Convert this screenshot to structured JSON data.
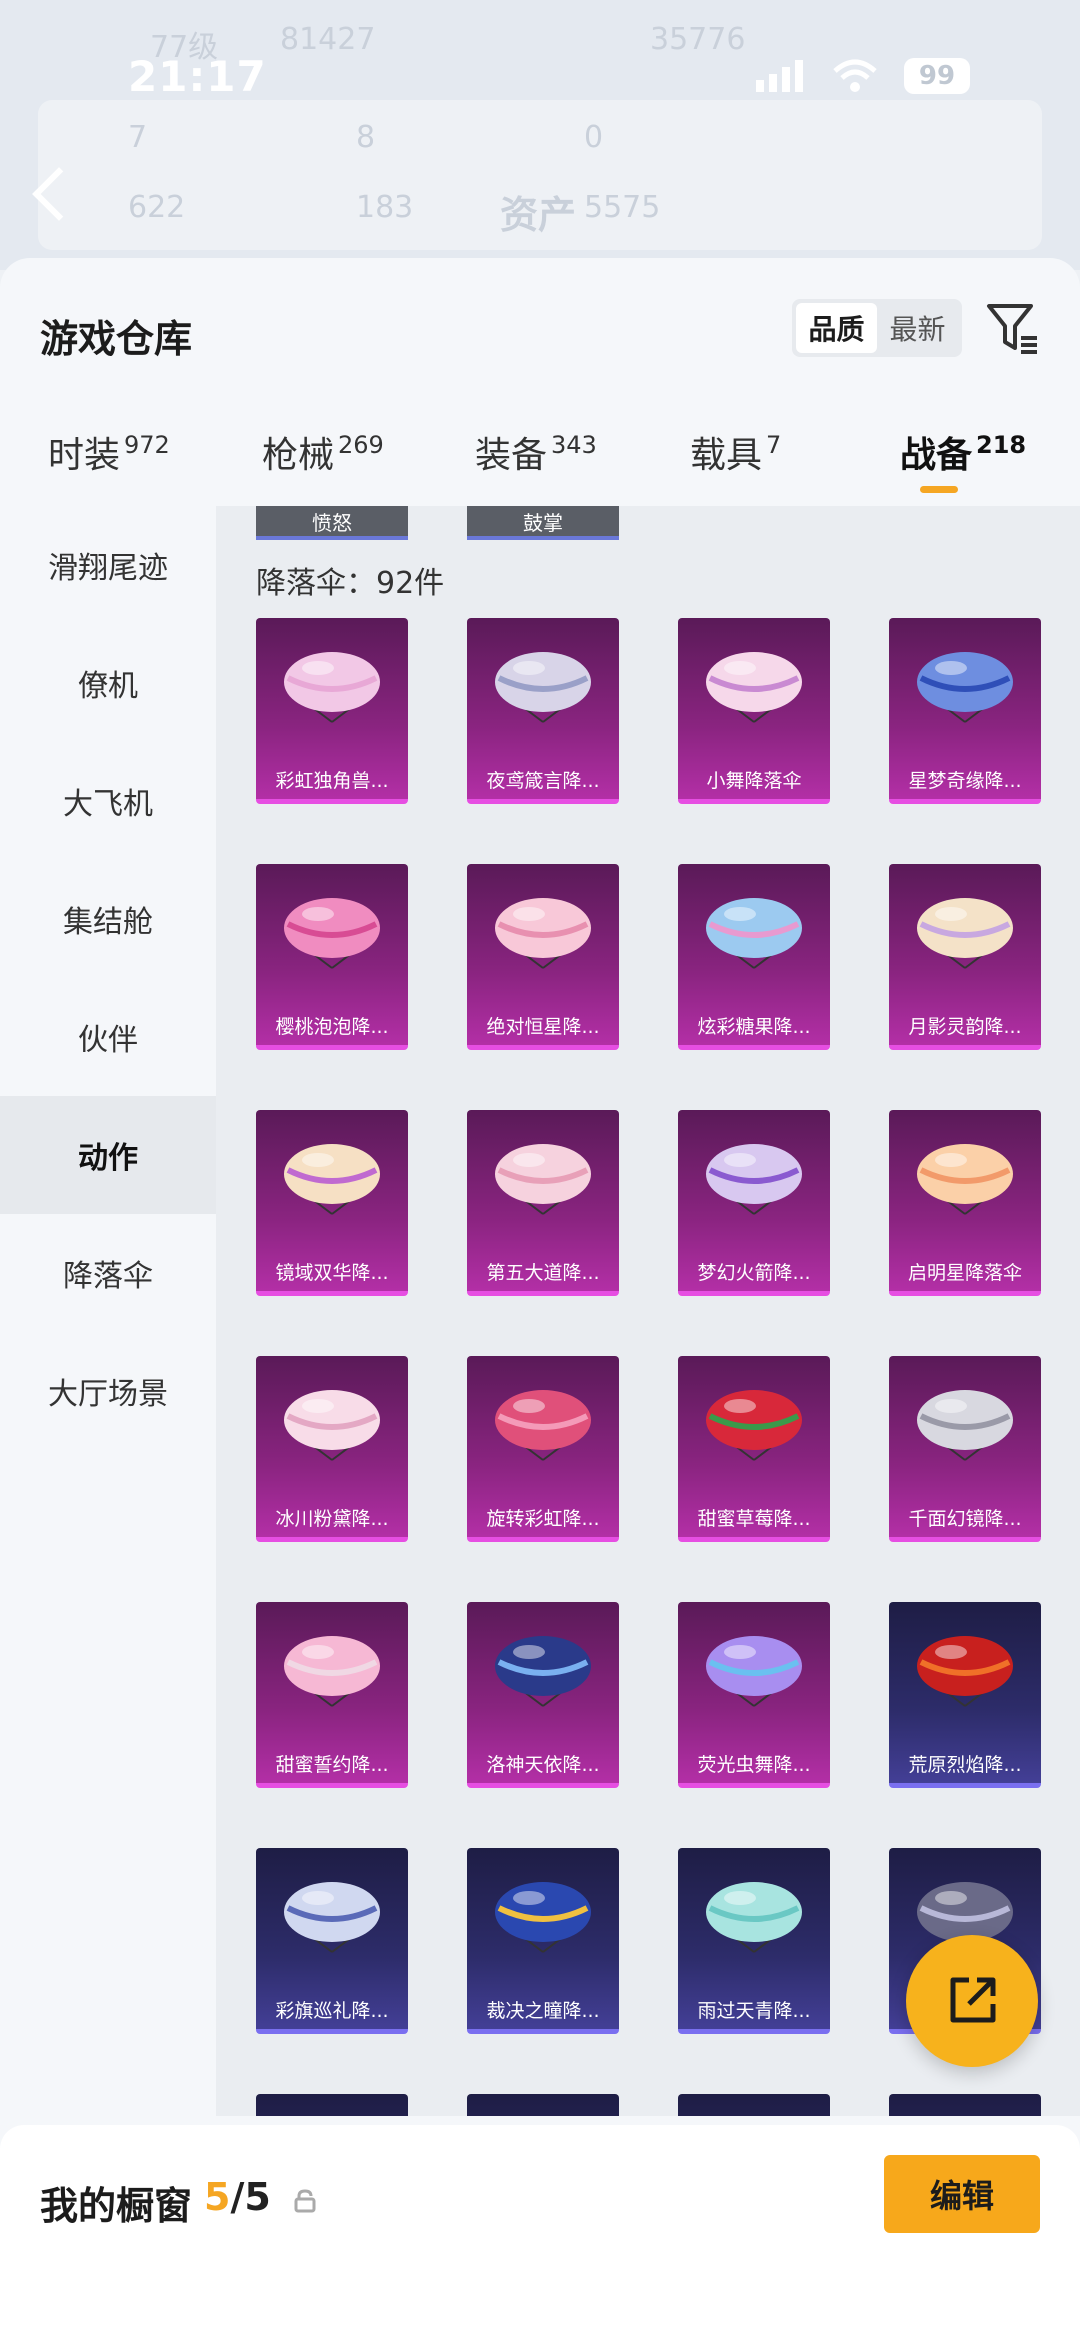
{
  "status_bar": {
    "time": "21:17",
    "battery": "99"
  },
  "bg_header": {
    "level": "77级",
    "score1": "81427",
    "score2": "35776",
    "stat_a": "7",
    "stat_b": "8",
    "stat_c": "0",
    "stat_d": "622",
    "stat_e": "183",
    "assets_label": "资产",
    "assets_value": "5575"
  },
  "sheet": {
    "title": "游戏仓库"
  },
  "sort": {
    "quality": "品质",
    "latest": "最新"
  },
  "tabs": [
    {
      "label": "时装",
      "count": "972"
    },
    {
      "label": "枪械",
      "count": "269"
    },
    {
      "label": "装备",
      "count": "343"
    },
    {
      "label": "载具",
      "count": "7"
    },
    {
      "label": "战备",
      "count": "218"
    }
  ],
  "sidebar": {
    "items": [
      "滑翔尾迹",
      "僚机",
      "大飞机",
      "集结舱",
      "伙伴",
      "动作",
      "降落伞",
      "大厅场景"
    ]
  },
  "chips": [
    "愤怒",
    "鼓掌"
  ],
  "section": {
    "count_label": "降落伞：92件"
  },
  "items": [
    {
      "name": "彩虹独角兽...",
      "color": "#f2c8e6",
      "accent": "#e8a8d6",
      "rarity": "purple"
    },
    {
      "name": "夜鸢箴言降...",
      "color": "#d8d4e8",
      "accent": "#9aa0c8",
      "rarity": "purple"
    },
    {
      "name": "小舞降落伞",
      "color": "#f6d8ea",
      "accent": "#c98ad2",
      "rarity": "purple"
    },
    {
      "name": "星梦奇缘降...",
      "color": "#6e8ee0",
      "accent": "#2f4fb8",
      "rarity": "purple"
    },
    {
      "name": "樱桃泡泡降...",
      "color": "#f08cc0",
      "accent": "#d84c94",
      "rarity": "purple"
    },
    {
      "name": "绝对恒星降...",
      "color": "#f8c8d8",
      "accent": "#e890b0",
      "rarity": "purple"
    },
    {
      "name": "炫彩糖果降...",
      "color": "#9ccaf0",
      "accent": "#e89ad0",
      "rarity": "purple"
    },
    {
      "name": "月影灵韵降...",
      "color": "#f4e2c8",
      "accent": "#c8a8e0",
      "rarity": "purple"
    },
    {
      "name": "镜域双华降...",
      "color": "#f6e0c4",
      "accent": "#c06ad0",
      "rarity": "purple"
    },
    {
      "name": "第五大道降...",
      "color": "#f6d2de",
      "accent": "#e8a0b8",
      "rarity": "purple"
    },
    {
      "name": "梦幻火箭降...",
      "color": "#d8c8f0",
      "accent": "#8a5ad0",
      "rarity": "purple"
    },
    {
      "name": "启明星降落伞",
      "color": "#fbd0a8",
      "accent": "#f29a6a",
      "rarity": "purple"
    },
    {
      "name": "冰川粉黛降...",
      "color": "#f8dce8",
      "accent": "#e4a8c4",
      "rarity": "purple"
    },
    {
      "name": "旋转彩虹降...",
      "color": "#e0507a",
      "accent": "#f49ab8",
      "rarity": "purple"
    },
    {
      "name": "甜蜜草莓降...",
      "color": "#d8283a",
      "accent": "#3a9a4a",
      "rarity": "purple"
    },
    {
      "name": "千面幻镜降...",
      "color": "#d8d8e0",
      "accent": "#9a9aa8",
      "rarity": "purple"
    },
    {
      "name": "甜蜜誓约降...",
      "color": "#f6b8d4",
      "accent": "#f0d8e4",
      "rarity": "purple"
    },
    {
      "name": "洛神天依降...",
      "color": "#2a3a8a",
      "accent": "#7ab0f0",
      "rarity": "purple"
    },
    {
      "name": "荧光虫舞降...",
      "color": "#a88ef0",
      "accent": "#6ac0f0",
      "rarity": "purple"
    },
    {
      "name": "荒原烈焰降...",
      "color": "#c8201e",
      "accent": "#f07028",
      "rarity": "blue"
    },
    {
      "name": "彩旗巡礼降...",
      "color": "#d0d8f0",
      "accent": "#5a6ab8",
      "rarity": "blue"
    },
    {
      "name": "裁决之瞳降...",
      "color": "#2a48b0",
      "accent": "#f0c040",
      "rarity": "blue"
    },
    {
      "name": "雨过天青降...",
      "color": "#a8e4e0",
      "accent": "#6ac8c4",
      "rarity": "blue"
    },
    {
      "name": "",
      "color": "#6a6a88",
      "accent": "#b8b8d8",
      "rarity": "blue"
    },
    {
      "name": "",
      "color": "#4a4a6a",
      "accent": "#6a6a88",
      "rarity": "blue"
    },
    {
      "name": "",
      "color": "#4a4a6a",
      "accent": "#6a6a88",
      "rarity": "blue"
    },
    {
      "name": "",
      "color": "#d8d8e0",
      "accent": "#9a9aa8",
      "rarity": "blue"
    },
    {
      "name": "",
      "color": "#6ac8e8",
      "accent": "#3a8ab8",
      "rarity": "blue"
    }
  ],
  "bottom_bar": {
    "label": "我的橱窗",
    "current": "5",
    "total": "/5",
    "edit": "编辑"
  },
  "colors": {
    "accent": "#f5a623",
    "purple_rarity": "#e64ee2",
    "blue_rarity": "#7a6ff0"
  }
}
